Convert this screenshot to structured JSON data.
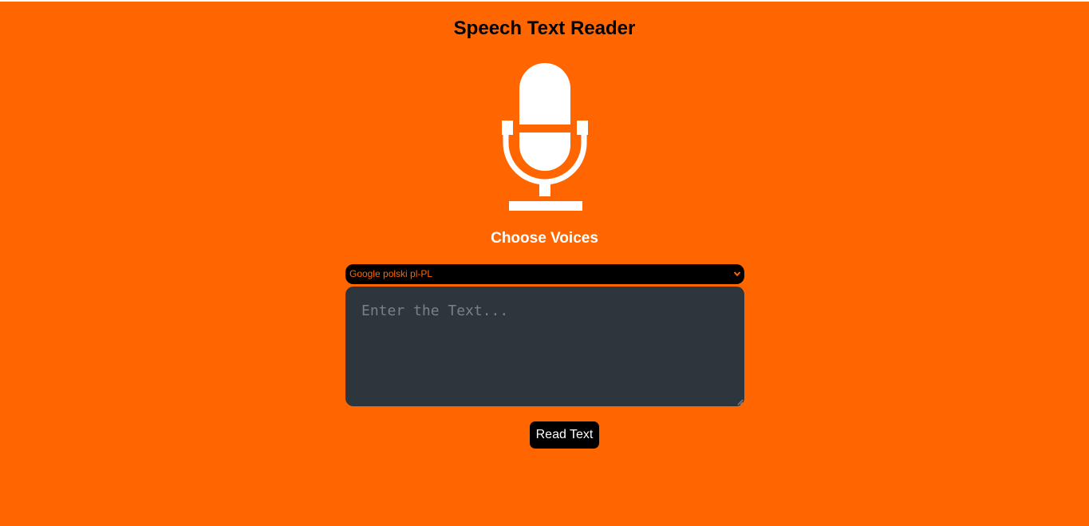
{
  "app": {
    "title": "Speech Text Reader"
  },
  "hero": {
    "icon": "microphone-icon"
  },
  "voices": {
    "heading": "Choose Voices",
    "selected": "Google polski pl-PL"
  },
  "text_input": {
    "value": "",
    "placeholder": "Enter the Text..."
  },
  "actions": {
    "read_label": "Read Text"
  },
  "colors": {
    "background": "#ff6600",
    "select_background": "#000000",
    "select_text": "#ff6600",
    "textarea_background": "#2d363d",
    "button_background": "#000000",
    "button_text": "#ffffff"
  }
}
